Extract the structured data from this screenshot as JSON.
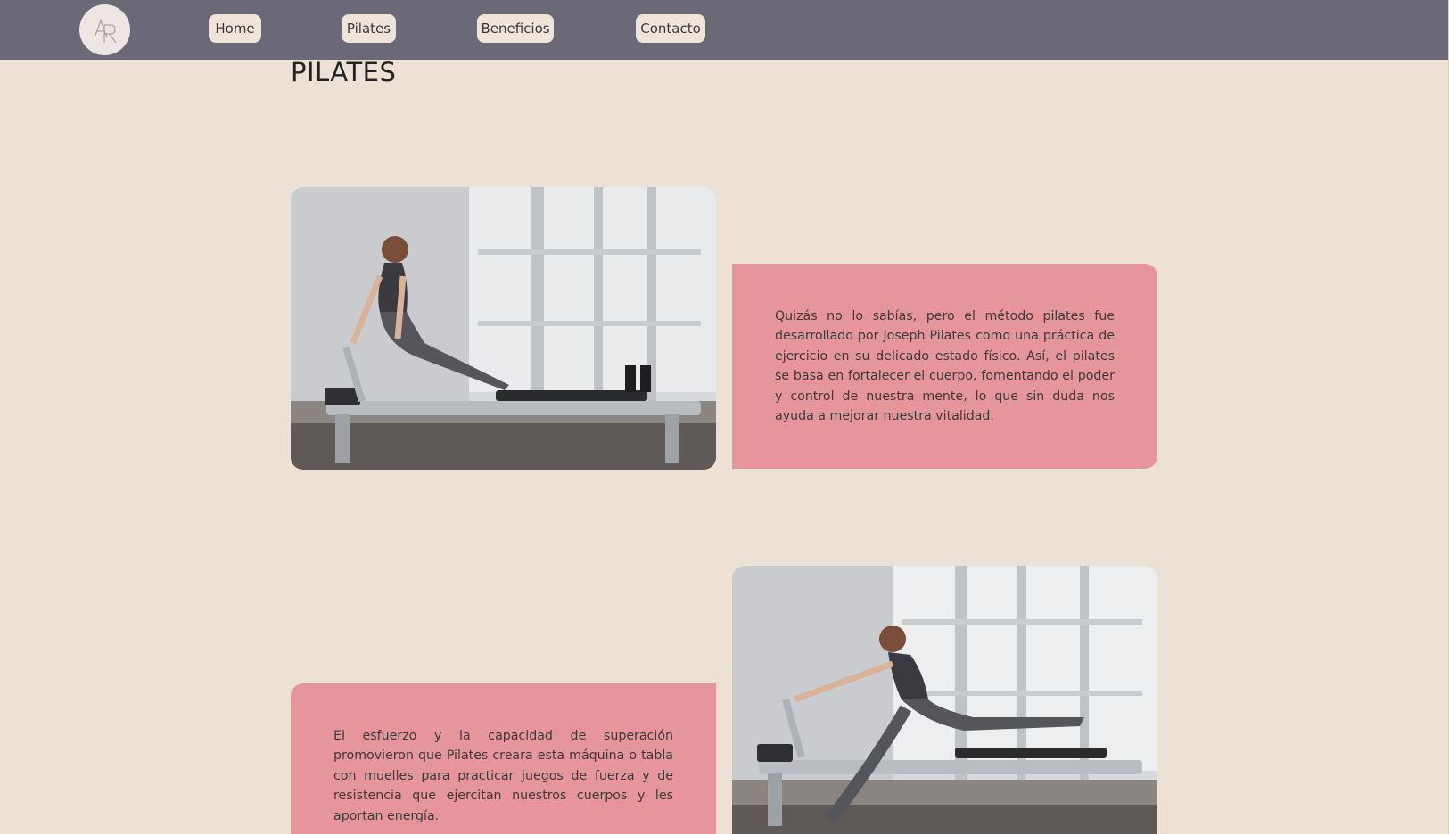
{
  "nav": {
    "logo_text": "AR",
    "items": [
      {
        "label": "Home"
      },
      {
        "label": "Pilates"
      },
      {
        "label": "Beneficios"
      },
      {
        "label": "Contacto"
      }
    ]
  },
  "main": {
    "title": "PILATES",
    "sections": [
      {
        "text": "Quizás no lo sabías, pero el método pilates fue desarrollado por Joseph Pilates como una práctica de ejercicio en su delicado estado físico. Así, el pilates se basa en fortalecer el cuerpo, fomentando el poder y control de nuestra mente, lo que sin duda nos ayuda a mejorar nuestra vitalidad."
      },
      {
        "text": "El esfuerzo y la capacidad de superación promovieron que Pilates creara esta máquina o tabla con muelles para practicar juegos de fuerza y de resistencia que ejercitan nuestros cuerpos y les aportan energía."
      }
    ]
  },
  "colors": {
    "navbar": "#6b6877",
    "page_background": "#ede0d5",
    "card_background": "#e5959b",
    "nav_button": "#f0e4da"
  }
}
